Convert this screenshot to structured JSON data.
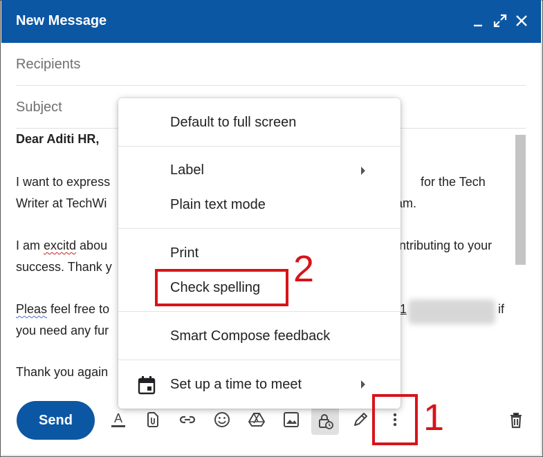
{
  "window": {
    "title": "New Message"
  },
  "fields": {
    "recipients_placeholder": "Recipients",
    "subject_placeholder": "Subject"
  },
  "body": {
    "greeting": "Dear Aditi HR,",
    "p1_line1_a": "I want to express",
    "p1_line1_b": "for the Tech",
    "p1_line2_a": "Writer at TechWi",
    "p1_line2_b": "am.",
    "p2_line1_a": "I am ",
    "p2_line1_misspelled": "excitd",
    "p2_line1_b": " abou",
    "p2_line1_c": "ontributing to your",
    "p2_line2_a": "success. Thank y",
    "p3_line1_misspelled": "Pleas",
    "p3_line1_a": " feel free to",
    "p3_line1_b": "1",
    "p3_line1_c": "if",
    "p3_line2_a": "you need any fur",
    "p4_line1_a": "Thank you again"
  },
  "menu": {
    "items": [
      "Default to full screen",
      "Label",
      "Plain text mode",
      "Print",
      "Check spelling",
      "Smart Compose feedback",
      "Set up a time to meet"
    ]
  },
  "toolbar": {
    "send_label": "Send"
  },
  "annotations": {
    "step1": "1",
    "step2": "2"
  },
  "colors": {
    "titlebar": "#0b57a4",
    "send_button": "#0b57a4",
    "annotation": "#d7141a"
  }
}
